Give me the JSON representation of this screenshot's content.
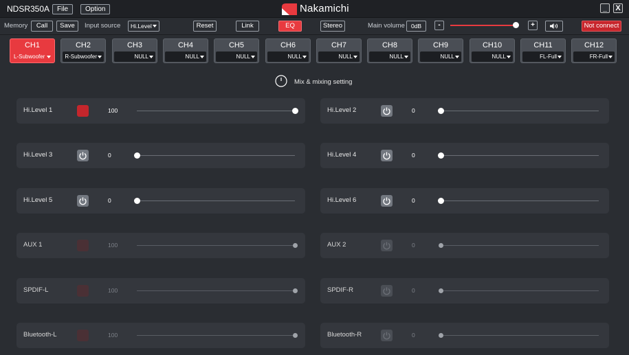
{
  "titlebar": {
    "app_title": "NDSR350A",
    "file_label": "File",
    "option_label": "Option",
    "brand": "Nakamichi",
    "minimize": "_",
    "close": "X"
  },
  "toolbar": {
    "memory_label": "Memory",
    "call_label": "Call",
    "save_label": "Save",
    "input_source_label": "Input source",
    "input_source_value": "Hi.Level",
    "reset_label": "Reset",
    "link_label": "Link",
    "eq_label": "EQ",
    "stereo_label": "Stereo",
    "main_volume_label": "Main volume",
    "main_volume_value": "0dB",
    "minus": "-",
    "plus": "+",
    "volume_level": 1.0,
    "connection_status": "Not connect"
  },
  "channels": [
    {
      "name": "CH1",
      "output": "L-Subwoofer",
      "active": true
    },
    {
      "name": "CH2",
      "output": "R-Subwoofer",
      "active": false
    },
    {
      "name": "CH3",
      "output": "NULL",
      "active": false
    },
    {
      "name": "CH4",
      "output": "NULL",
      "active": false
    },
    {
      "name": "CH5",
      "output": "NULL",
      "active": false
    },
    {
      "name": "CH6",
      "output": "NULL",
      "active": false
    },
    {
      "name": "CH7",
      "output": "NULL",
      "active": false
    },
    {
      "name": "CH8",
      "output": "NULL",
      "active": false
    },
    {
      "name": "CH9",
      "output": "NULL",
      "active": false
    },
    {
      "name": "CH10",
      "output": "NULL",
      "active": false
    },
    {
      "name": "CH11",
      "output": "FL-Full",
      "active": false
    },
    {
      "name": "CH12",
      "output": "FR-Full",
      "active": false
    }
  ],
  "mix": {
    "title": "Mix & mixing setting",
    "rows": [
      {
        "label": "Hi.Level 1",
        "value": "100",
        "level": 1.0,
        "power": "on",
        "dim": false
      },
      {
        "label": "Hi.Level 2",
        "value": "0",
        "level": 0.0,
        "power": "off",
        "dim": false
      },
      {
        "label": "Hi.Level 3",
        "value": "0",
        "level": 0.0,
        "power": "off",
        "dim": false
      },
      {
        "label": "Hi.Level 4",
        "value": "0",
        "level": 0.0,
        "power": "off",
        "dim": false
      },
      {
        "label": "Hi.Level 5",
        "value": "0",
        "level": 0.0,
        "power": "off",
        "dim": false
      },
      {
        "label": "Hi.Level 6",
        "value": "0",
        "level": 0.0,
        "power": "off",
        "dim": false
      },
      {
        "label": "AUX 1",
        "value": "100",
        "level": 1.0,
        "power": "on",
        "dim": true
      },
      {
        "label": "AUX  2",
        "value": "0",
        "level": 0.0,
        "power": "off",
        "dim": true
      },
      {
        "label": "SPDIF-L",
        "value": "100",
        "level": 1.0,
        "power": "on",
        "dim": true
      },
      {
        "label": "SPDIF-R",
        "value": "0",
        "level": 0.0,
        "power": "off",
        "dim": true
      },
      {
        "label": "Bluetooth-L",
        "value": "100",
        "level": 1.0,
        "power": "on",
        "dim": true
      },
      {
        "label": "Bluetooth-R",
        "value": "0",
        "level": 0.0,
        "power": "off",
        "dim": true
      }
    ]
  },
  "colors": {
    "accent_red": "#e83a3f",
    "background": "#2a2d32",
    "row_background": "#34373d"
  },
  "icons": {
    "power": "power-icon",
    "speaker": "speaker-icon",
    "dropdown": "chevron-down-icon"
  }
}
